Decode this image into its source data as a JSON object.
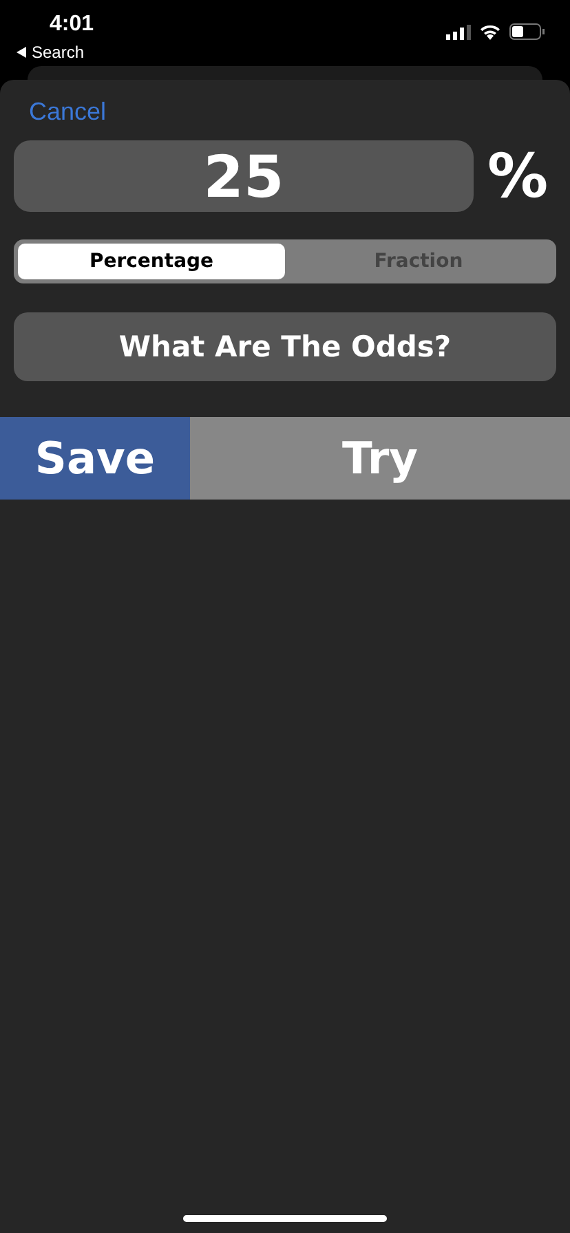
{
  "status_bar": {
    "time": "4:01",
    "back_label": "Search"
  },
  "cancel": "Cancel",
  "percent_field": {
    "value": "25",
    "unit": "%"
  },
  "segments": [
    {
      "label": "Percentage",
      "selected": true
    },
    {
      "label": "Fraction",
      "selected": false
    }
  ],
  "odds_button": "What Are The Odds?",
  "actions": [
    {
      "label": "Save",
      "kind": "primary"
    },
    {
      "label": "Try",
      "kind": "secondary"
    }
  ]
}
